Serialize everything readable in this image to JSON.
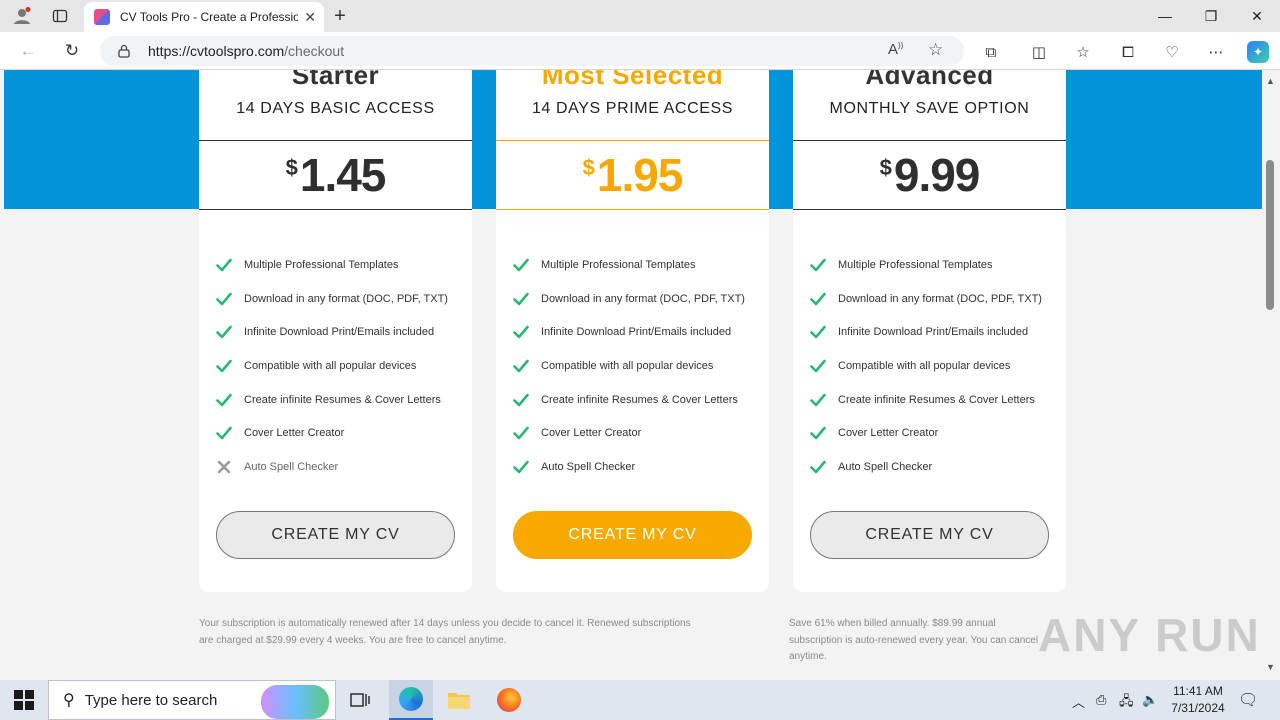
{
  "browser": {
    "tab_title": "CV Tools Pro - Create a Profession",
    "url_host": "https://cvtoolspro.com",
    "url_path": "/checkout"
  },
  "plans": [
    {
      "name": "Starter",
      "subtitle": "14 DAYS BASIC ACCESS",
      "currency": "$",
      "price": "1.45",
      "highlight": false,
      "features": [
        {
          "text": "Multiple Professional Templates",
          "included": true
        },
        {
          "text": "Download in any format (DOC, PDF, TXT)",
          "included": true
        },
        {
          "text": "Infinite Download Print/Emails included",
          "included": true
        },
        {
          "text": "Compatible with all popular devices",
          "included": true
        },
        {
          "text": "Create infinite Resumes & Cover Letters",
          "included": true
        },
        {
          "text": "Cover Letter Creator",
          "included": true
        },
        {
          "text": "Auto Spell Checker",
          "included": false
        }
      ],
      "cta": "CREATE MY CV"
    },
    {
      "name": "Most Selected",
      "subtitle": "14 DAYS PRIME ACCESS",
      "currency": "$",
      "price": "1.95",
      "highlight": true,
      "features": [
        {
          "text": "Multiple Professional Templates",
          "included": true
        },
        {
          "text": "Download in any format (DOC, PDF, TXT)",
          "included": true
        },
        {
          "text": "Infinite Download Print/Emails included",
          "included": true
        },
        {
          "text": "Compatible with all popular devices",
          "included": true
        },
        {
          "text": "Create infinite Resumes & Cover Letters",
          "included": true
        },
        {
          "text": "Cover Letter Creator",
          "included": true
        },
        {
          "text": "Auto Spell Checker",
          "included": true
        }
      ],
      "cta": "CREATE MY CV"
    },
    {
      "name": "Advanced",
      "subtitle": "MONTHLY SAVE OPTION",
      "currency": "$",
      "price": "9.99",
      "highlight": false,
      "features": [
        {
          "text": "Multiple Professional Templates",
          "included": true
        },
        {
          "text": "Download in any format (DOC, PDF, TXT)",
          "included": true
        },
        {
          "text": "Infinite Download Print/Emails included",
          "included": true
        },
        {
          "text": "Compatible with all popular devices",
          "included": true
        },
        {
          "text": "Create infinite Resumes & Cover Letters",
          "included": true
        },
        {
          "text": "Cover Letter Creator",
          "included": true
        },
        {
          "text": "Auto Spell Checker",
          "included": true
        }
      ],
      "cta": "CREATE MY CV"
    }
  ],
  "footnotes": {
    "left": "Your subscription is automatically renewed after 14 days unless you decide to cancel it. Renewed subscriptions are charged at $29.99 every 4 weeks. You are free to cancel anytime.",
    "right": "Save 61% when billed annually. $89.99 annual subscription is auto-renewed every year. You can cancel anytime."
  },
  "watermark": "ANY RUN",
  "taskbar": {
    "search_placeholder": "Type here to search",
    "time": "11:41 AM",
    "date": "7/31/2024"
  },
  "colors": {
    "band_blue": "#0393d8",
    "gold": "#f6a800",
    "check_green": "#2bb673",
    "cross_gray": "#9a9a9a"
  }
}
